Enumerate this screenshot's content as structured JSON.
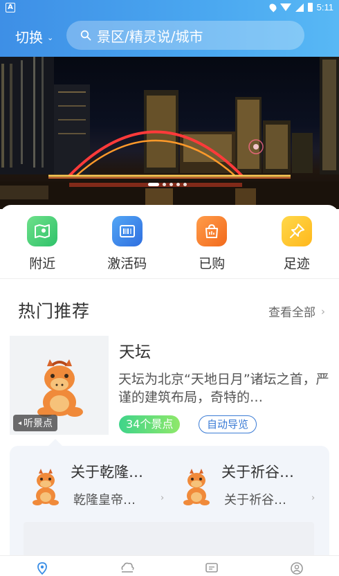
{
  "status_bar": {
    "time": "5:11",
    "left_icon": "A"
  },
  "header": {
    "switch_label": "切换",
    "search_placeholder": "景区/精灵说/城市"
  },
  "banner": {
    "slide_count": 5,
    "active_slide": 1
  },
  "quick_actions": [
    {
      "label": "附近",
      "icon": "map-icon",
      "color": "#3ccf75"
    },
    {
      "label": "激活码",
      "icon": "barcode-icon",
      "color": "#3a86ea"
    },
    {
      "label": "已购",
      "icon": "shopping-bag-icon",
      "color": "#f5782a"
    },
    {
      "label": "足迹",
      "icon": "pin-icon",
      "color": "#ffc72a"
    }
  ],
  "recommend": {
    "title": "热门推荐",
    "see_all": "查看全部",
    "featured": {
      "name": "天坛",
      "description": "天坛为北京“天地日月”诸坛之首，严谨的建筑布局，奇特的…",
      "spots_badge": "34个景点",
      "auto_guide": "自动导览",
      "listen_badge": "听景点"
    },
    "sub_spots": [
      {
        "title": "关于乾隆…",
        "desc": "乾隆皇帝…"
      },
      {
        "title": "关于祈谷…",
        "desc": "关于祈谷…"
      }
    ]
  },
  "tabbar": {
    "tabs": [
      {
        "icon": "location-icon",
        "active": true
      },
      {
        "icon": "cloud-mountain-icon",
        "active": false
      },
      {
        "icon": "message-icon",
        "active": false
      },
      {
        "icon": "profile-icon",
        "active": false
      }
    ],
    "active_color": "#3a8ee6",
    "inactive_color": "#999999"
  }
}
